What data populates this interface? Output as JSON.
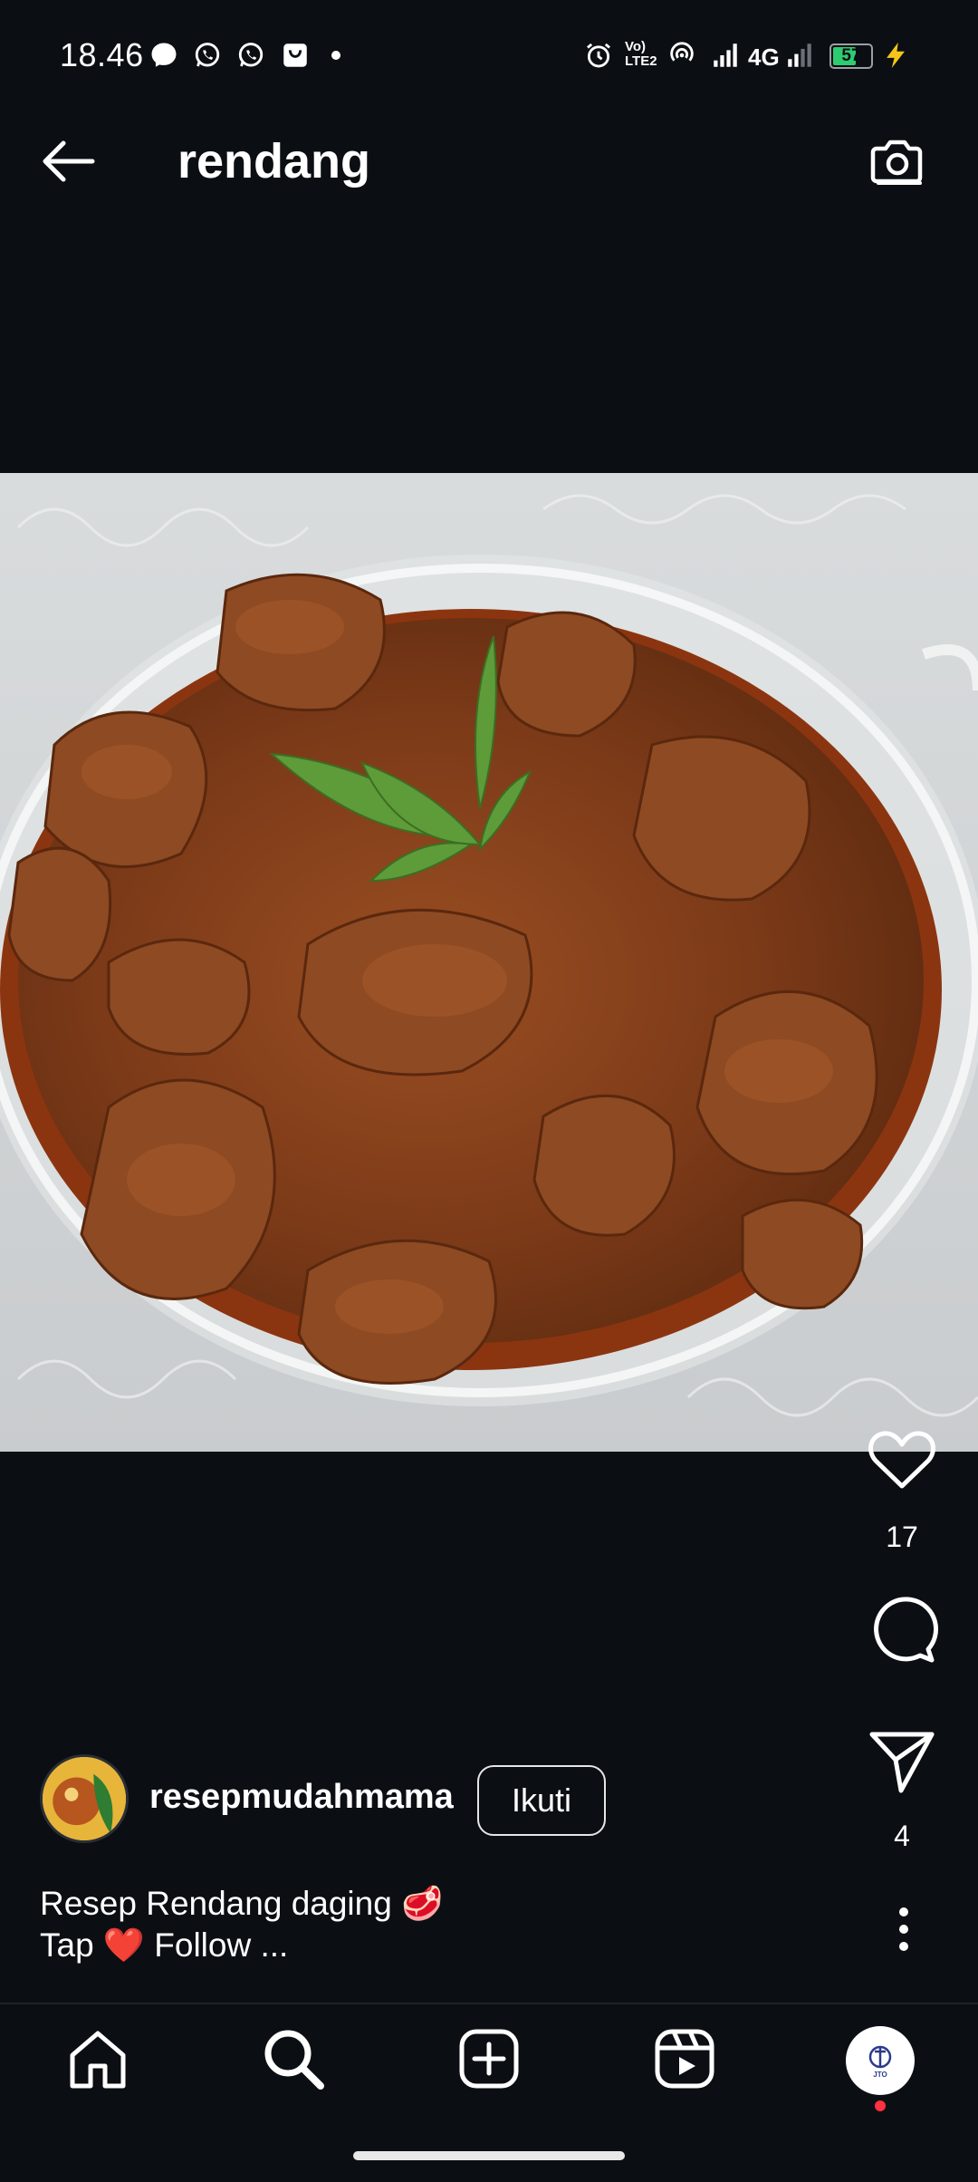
{
  "status_bar": {
    "time": "18.46",
    "battery_level": "57",
    "network_label": "4G",
    "volte_label": "Vo) LTE2",
    "icons": [
      "messenger-icon",
      "whatsapp-icon",
      "whatsapp-icon",
      "shopping-bag-icon",
      "dot-icon",
      "alarm-icon",
      "volte-icon",
      "hotspot-icon",
      "signal-icon",
      "signal-icon",
      "battery-icon",
      "charging-icon"
    ]
  },
  "header": {
    "title": "rendang",
    "back_icon": "arrow-left-icon",
    "camera_icon": "camera-icon"
  },
  "post": {
    "image_alt": "Rendang daging",
    "likes": "17",
    "shares": "4",
    "author": {
      "username": "resepmudahmama",
      "follow_label": "Ikuti"
    },
    "caption_line1": "Resep Rendang daging 🥩",
    "caption_line2": "Tap ❤️ Follow ..."
  },
  "bottom_nav": {
    "items": [
      "home-icon",
      "search-icon",
      "create-icon",
      "reels-icon",
      "profile-avatar"
    ],
    "profile_badge": "JTO"
  },
  "colors": {
    "background": "#0b0f14",
    "text": "#ffffff",
    "notification_dot": "#ff3040",
    "battery_fill": "#2ecc71"
  }
}
